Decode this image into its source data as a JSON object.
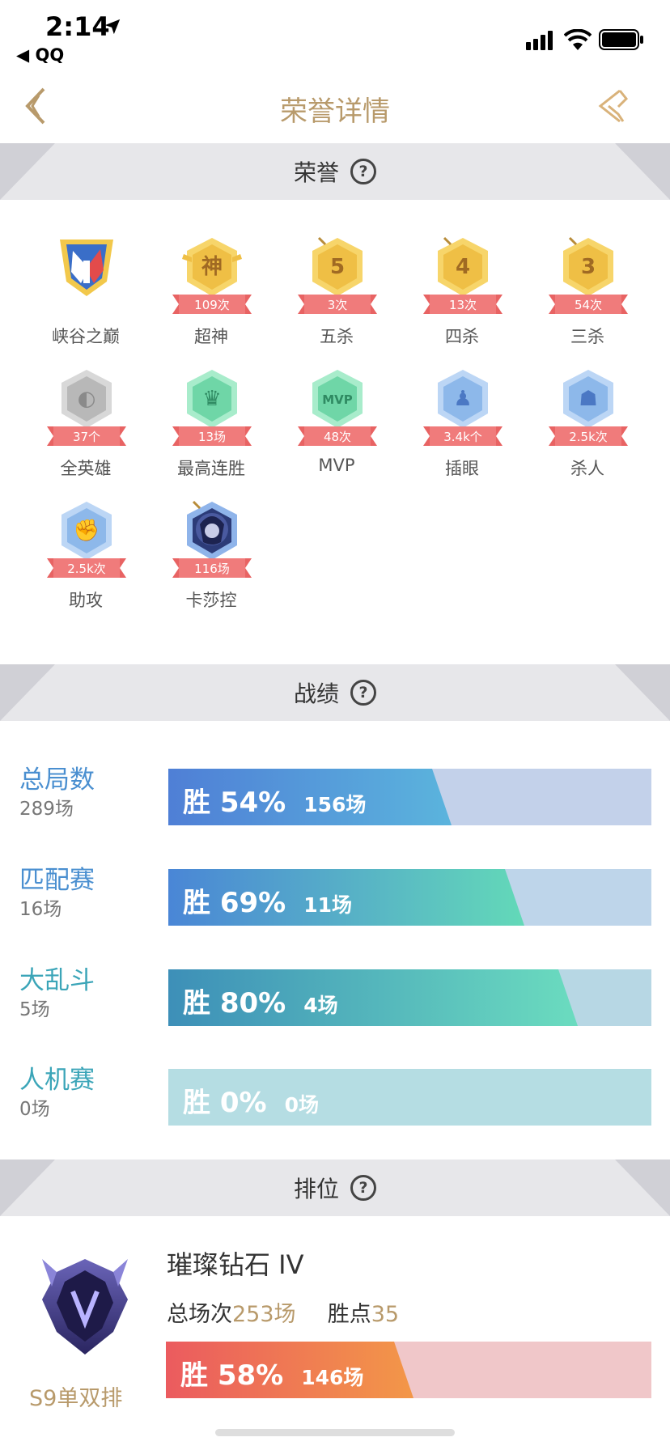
{
  "status_bar": {
    "time": "2:14",
    "back_app": "◀ QQ"
  },
  "nav": {
    "title": "荣誉详情"
  },
  "sections": {
    "honor": "荣誉",
    "record": "战绩",
    "ranked": "排位",
    "help": "?"
  },
  "colors": {
    "gold": "#b89a6b",
    "blue_label": "#4a8fd0",
    "teal_label": "#3ba5b8"
  },
  "honors": [
    {
      "label": "峡谷之巅",
      "count": "",
      "icon": "peak-emblem-icon",
      "style": "peak"
    },
    {
      "label": "超神",
      "count": "109次",
      "glyph": "神",
      "icon": "godlike-icon",
      "style": "gold"
    },
    {
      "label": "五杀",
      "count": "3次",
      "glyph": "5",
      "icon": "penta-kill-icon",
      "style": "gold"
    },
    {
      "label": "四杀",
      "count": "13次",
      "glyph": "4",
      "icon": "quadra-kill-icon",
      "style": "gold"
    },
    {
      "label": "三杀",
      "count": "54次",
      "glyph": "3",
      "icon": "triple-kill-icon",
      "style": "gold"
    },
    {
      "label": "全英雄",
      "count": "37个",
      "glyph": "◐",
      "icon": "all-heroes-icon",
      "style": "gray"
    },
    {
      "label": "最高连胜",
      "count": "13场",
      "glyph": "♛",
      "icon": "win-streak-icon",
      "style": "green"
    },
    {
      "label": "MVP",
      "count": "48次",
      "glyph": "MVP",
      "icon": "mvp-icon",
      "style": "green"
    },
    {
      "label": "插眼",
      "count": "3.4k个",
      "glyph": "♟",
      "icon": "ward-icon",
      "style": "blue"
    },
    {
      "label": "杀人",
      "count": "2.5k次",
      "glyph": "☗",
      "icon": "kills-icon",
      "style": "blue"
    },
    {
      "label": "助攻",
      "count": "2.5k次",
      "glyph": "✊",
      "icon": "assists-icon",
      "style": "blue"
    },
    {
      "label": "卡莎控",
      "count": "116场",
      "glyph": "",
      "icon": "kaisa-portrait-icon",
      "style": "portrait"
    }
  ],
  "records": [
    {
      "name": "总局数",
      "sub": "289场",
      "win_label": "胜 54%",
      "games": "156场",
      "win_rate": 0.54,
      "name_color": "#4a8fd0",
      "grad": [
        "#4f7fd6",
        "#5bb4dd"
      ],
      "track": "#c3d1ea"
    },
    {
      "name": "匹配赛",
      "sub": "16场",
      "win_label": "胜 69%",
      "games": "11场",
      "win_rate": 0.69,
      "name_color": "#4a8fd0",
      "grad": [
        "#4a86d6",
        "#63d9b8"
      ],
      "track": "#bed5ea"
    },
    {
      "name": "大乱斗",
      "sub": "5场",
      "win_label": "胜 80%",
      "games": "4场",
      "win_rate": 0.8,
      "name_color": "#3ba5b8",
      "grad": [
        "#3d8fb8",
        "#6bdcbf"
      ],
      "track": "#b7d7e4"
    },
    {
      "name": "人机赛",
      "sub": "0场",
      "win_label": "胜 0%",
      "games": "0场",
      "win_rate": 0.0,
      "name_color": "#3ba5b8",
      "grad": [
        "#b5dde3",
        "#b5dde3"
      ],
      "track": "#b5dde3"
    }
  ],
  "ranked": {
    "title": "璀璨钻石 IV",
    "total_label": "总场次",
    "total_value": "253场",
    "points_label": "胜点",
    "points_value": "35",
    "win_label": "胜 58%",
    "games": "146场",
    "win_rate": 0.58,
    "season": "S9单双排"
  }
}
